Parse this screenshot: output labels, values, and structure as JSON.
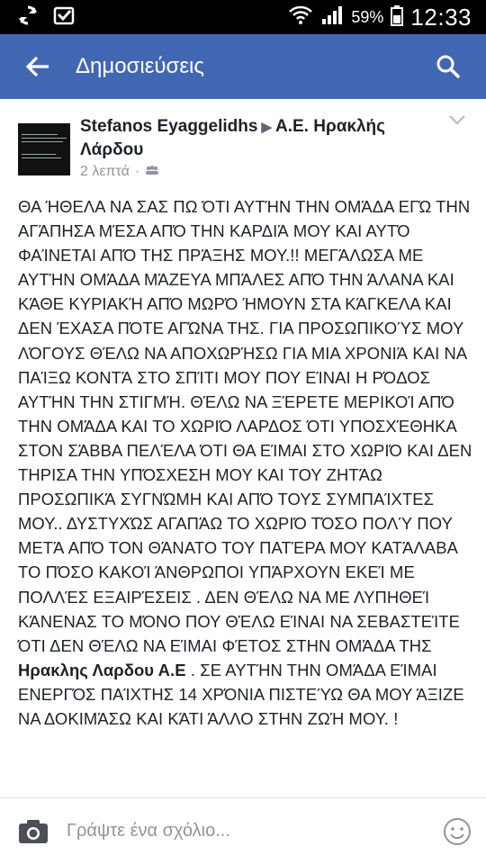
{
  "status_bar": {
    "battery": "59%",
    "time": "12:33",
    "icons": [
      "sync-icon",
      "download-icon",
      "wifi-icon",
      "signal-icon",
      "battery-icon"
    ]
  },
  "app_bar": {
    "title": "Δημοσιεύσεις",
    "color": "#4267b2"
  },
  "post": {
    "author": "Stefanos Eyaggelidhs",
    "target_line1": "Α.Ε. Ηρακλής",
    "target_line2": "Λάρδου",
    "time": "2 λεπτά",
    "body_before_bold": "ΘΑ ΉΘΕΛΑ ΝΑ ΣΑΣ ΠΩ ΌΤΙ ΑΥΤΉΝ ΤΗΝ ΟΜΆΔΑ ΕΓΏ ΤΗΝ ΑΓΆΠΗΣΑ ΜΈΣΑ ΑΠΌ ΤΗΝ ΚΑΡΔΙΆ ΜΟΥ ΚΑΙ ΑΥΤΌ ΦΑΊΝΕΤΑΙ ΑΠΌ ΤΗΣ ΠΡΆΞΗΣ ΜΟΥ.!! ΜΕΓΆΛΩΣΑ ΜΕ ΑΥΤΉΝ ΟΜΆΔΑ ΜΆΖΕΥΑ ΜΠΆΛΕΣ ΑΠΌ ΤΗΝ ΆΛΑΝΑ ΚΑΙ ΚΆΘΕ ΚΥΡΙΑΚΉ ΑΠΌ ΜΩΡΌ ΉΜΟΥΝ ΣΤΑ ΚΆΓΚΕΛΑ ΚΑΙ ΔΕΝ ΈΧΑΣΑ ΠΌΤΕ ΑΓΏΝΑ ΤΗΣ. ΓΙΑ ΠΡΟΣΩΠΙΚΟΎΣ ΜΟΥ ΛΌΓΟΥΣ ΘΈΛΩ ΝΑ ΑΠΟΧΩΡΉΣΩ ΓΙΑ ΜΙΑ ΧΡΟΝΙΆ ΚΑΙ ΝΑ ΠΑΊΞΩ ΚΟΝΤΆ ΣΤΟ ΣΠΊΤΙ ΜΟΥ ΠΟΥ ΕΊΝΑΙ Η ΡΌΔΟΣ ΑΥΤΉΝ ΤΗΝ ΣΤΙΓΜΉ. ΘΈΛΩ ΝΑ ΞΈΡΕΤΕ ΜΕΡΙΚΟΊ ΑΠΌ ΤΗΝ ΟΜΆΔΑ ΚΑΙ ΤΟ ΧΩΡΙΌ ΛΑΡΔΟΣ ΌΤΙ ΥΠΟΣΧΈΘΗΚΑ ΣΤΟΝ ΣΆΒΒΑ ΠΕΛΈΛΑ ΌΤΙ ΘΑ ΕΊΜΑΙ ΣΤΟ ΧΩΡΙΌ ΚΑΙ ΔΕΝ ΤΗΡΙΣΑ ΤΗΝ ΥΠΌΣΧΕΣΗ ΜΟΥ ΚΑΙ ΤΟΥ ΖΗΤΆΩ ΠΡΟΣΩΠΙΚΆ ΣΥΓΝΏΜΗ ΚΑΙ ΑΠΌ ΤΟΥΣ ΣΥΜΠΑΊΧΤΕΣ ΜΟΥ.. ΔΥΣΤΥΧΏΣ ΑΓΑΠΆΩ ΤΟ ΧΩΡΙΌ ΤΌΣΟ ΠΟΛΎ ΠΟΥ ΜΕΤΆ ΑΠΌ ΤΟΝ ΘΆΝΑΤΟ ΤΟΥ ΠΑΤΈΡΑ ΜΟΥ ΚΑΤΆΛΑΒΑ ΤΟ ΠΌΣΟ ΚΑΚΟΊ ΆΝΘΡΩΠΟΙ ΥΠΆΡΧΟΥΝ ΕΚΕΊ ΜΕ ΠΟΛΛΈΣ ΕΞΑΙΡΈΣΕΙΣ . ΔΕΝ ΘΈΛΩ ΝΑ ΜΕ ΛΥΠΗΘΕΊ ΚΆΝΕΝΑΣ ΤΟ ΜΌΝΟ ΠΟΥ ΘΈΛΩ ΕΊΝΑΙ ΝΑ ΣΕΒΑΣΤΕΊΤΕ ΌΤΙ ΔΕΝ ΘΈΛΩ ΝΑ ΕΊΜΑΙ ΦΈΤΟΣ ΣΤΗΝ ΟΜΆΔΑ ΤΗΣ ",
    "body_bold": "Ηρακλης Λαρδου Α.Ε",
    "body_after_bold": " . ΣΕ ΑΥΤΉΝ ΤΗΝ ΟΜΆΔΑ ΕΊΜΑΙ ΕΝΕΡΓΌΣ ΠΑΊΧΤΗΣ 14 ΧΡΌΝΙΑ ΠΙΣΤΕΎΩ ΘΑ ΜΟΥ ΆΞΙΖΕ ΝΑ ΔΟΚΙΜΆΣΩ ΚΑΙ ΚΆΤΙ ΆΛΛΟ ΣΤΗΝ ΖΩΉ ΜΟΥ. !"
  },
  "comment_bar": {
    "placeholder": "Γράψτε ένα σχόλιο..."
  }
}
